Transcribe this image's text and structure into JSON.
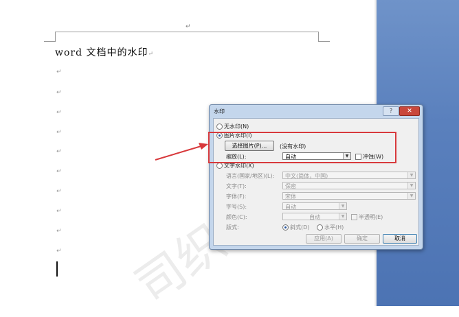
{
  "document": {
    "title": "word 文档中的水印",
    "paragraph_mark": "↵",
    "watermark_text": "司织"
  },
  "dialog": {
    "title": "水印",
    "help_label": "?",
    "close_label": "✕",
    "no_watermark": "无水印(N)",
    "picture_watermark": "图片水印(I)",
    "select_picture_button": "选择图片(P)...",
    "no_picture_text": "(没有水印)",
    "scale_label": "缩放(L):",
    "scale_value": "自动",
    "washout_label": "冲蚀(W)",
    "text_watermark": "文字水印(X)",
    "language_label": "语言(国家/地区)(L):",
    "language_value": "中文(简体，中国)",
    "text_label": "文字(T):",
    "text_value": "保密",
    "font_label": "字体(F):",
    "font_value": "宋体",
    "size_label": "字号(S):",
    "size_value": "自动",
    "color_label": "颜色(C):",
    "color_value": "自动",
    "semitransparent_label": "半透明(E)",
    "layout_label": "版式:",
    "diagonal_label": "斜式(D)",
    "horizontal_label": "水平(H)",
    "apply_button": "应用(A)",
    "ok_button": "确定",
    "cancel_button": "取消"
  },
  "colors": {
    "highlight_box": "#d8393c",
    "arrow": "#d8393c",
    "desktop_blue": "#5a80bd"
  }
}
